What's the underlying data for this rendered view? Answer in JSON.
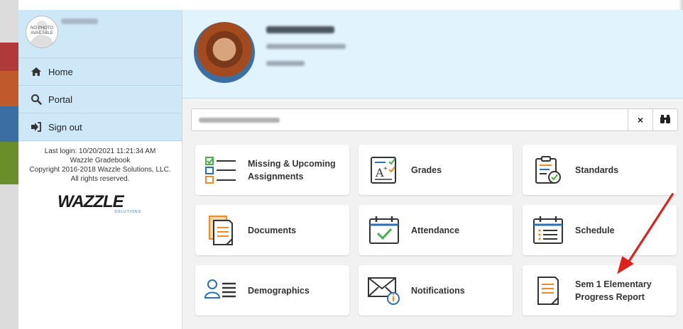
{
  "sidebar": {
    "nophoto_text": "NO PHOTO AVAILABLE",
    "nav": [
      {
        "label": "Home",
        "icon": "home-icon"
      },
      {
        "label": "Portal",
        "icon": "search-icon"
      },
      {
        "label": "Sign out",
        "icon": "sign-out-icon"
      }
    ],
    "last_login": "Last login: 10/20/2021 11:21:34 AM",
    "product": "Wazzle Gradebook",
    "copyright": "Copyright 2016-2018 Wazzle Solutions, LLC.",
    "rights": "All rights reserved.",
    "logo_text": "WAZZLE",
    "logo_sub": "SOLUTIONS"
  },
  "toolbar": {
    "clear_label": "×"
  },
  "tiles": [
    {
      "label": "Missing & Upcoming Assignments",
      "icon": "checklist-icon"
    },
    {
      "label": "Grades",
      "icon": "grades-icon"
    },
    {
      "label": "Standards",
      "icon": "clipboard-check-icon"
    },
    {
      "label": "Documents",
      "icon": "documents-icon"
    },
    {
      "label": "Attendance",
      "icon": "calendar-check-icon"
    },
    {
      "label": "Schedule",
      "icon": "calendar-list-icon"
    },
    {
      "label": "Demographics",
      "icon": "person-list-icon"
    },
    {
      "label": "Notifications",
      "icon": "envelope-info-icon"
    },
    {
      "label": "Sem 1 Elementary Progress Report",
      "icon": "report-icon"
    }
  ],
  "colors": {
    "sidebar_bg": "#cfe8f7",
    "profile_bg": "#e1f3fd",
    "accent_orange": "#f08a24",
    "accent_green": "#4cae4c",
    "accent_blue": "#2a70b8",
    "arrow_red": "#e0201b"
  }
}
